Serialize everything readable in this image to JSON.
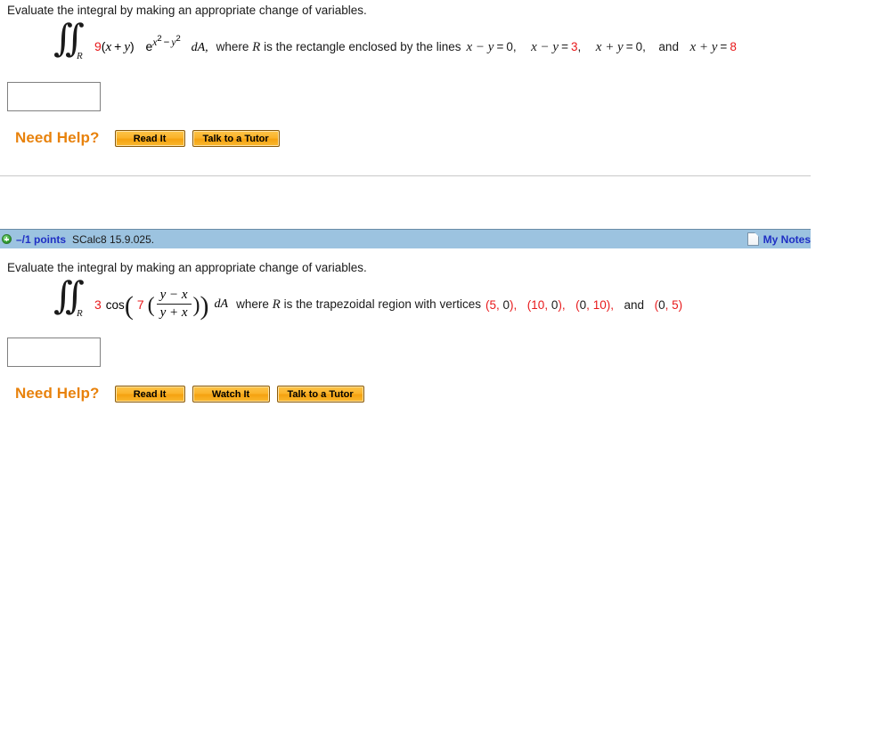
{
  "problem1": {
    "prompt": "Evaluate the integral by making an appropriate change of variables.",
    "integral": {
      "symbol": "∫∫",
      "subscript": "R",
      "coefficient": "9",
      "factor_open": "(",
      "var_x": "x",
      "plus": "+",
      "var_y": "y",
      "factor_close": ")",
      "exp_base": "e",
      "exp_x": "x",
      "exp_x_power": "2",
      "exp_minus": "−",
      "exp_y": "y",
      "exp_y_power": "2",
      "differential": "dA,"
    },
    "where_text_1": "where",
    "where_R": "R",
    "where_text_2": "is the rectangle enclosed by the lines",
    "lines": [
      {
        "lhs": "x − y",
        "eq": "=",
        "rhs": "0",
        "rhs_red": false,
        "trail": ","
      },
      {
        "lhs": "x − y",
        "eq": "=",
        "rhs": "3",
        "rhs_red": true,
        "trail": ","
      },
      {
        "lhs": "x + y",
        "eq": "=",
        "rhs": "0",
        "rhs_red": false,
        "trail": ","
      },
      {
        "lhs": "x + y",
        "eq": "=",
        "rhs": "8",
        "rhs_red": true,
        "trail": ""
      }
    ],
    "and_word": "and",
    "answer_value": "",
    "answer_placeholder": "",
    "need_help_label": "Need Help?",
    "help_buttons": [
      "Read It",
      "Talk to a Tutor"
    ]
  },
  "problem2": {
    "bar": {
      "points": "–/1 points",
      "question_id": "SCalc8 15.9.025.",
      "my_notes": "My Notes"
    },
    "prompt": "Evaluate the integral by making an appropriate change of variables.",
    "integral": {
      "symbol": "∫∫",
      "subscript": "R",
      "coefficient": "3",
      "function": "cos",
      "inner_coefficient": "7",
      "numerator": "y − x",
      "denominator": "y + x",
      "differential": "dA"
    },
    "where_text_1": "where",
    "where_R": "R",
    "where_text_2": "is the trapezoidal region with vertices",
    "vertices": [
      {
        "x": "5",
        "x_red": true,
        "y": "0",
        "y_red": false,
        "trail": ","
      },
      {
        "x": "10",
        "x_red": true,
        "y": "0",
        "y_red": false,
        "trail": ","
      },
      {
        "x": "0",
        "x_red": false,
        "y": "10",
        "y_red": true,
        "trail": ","
      },
      {
        "x": "0",
        "x_red": false,
        "y": "5",
        "y_red": true,
        "trail": ""
      }
    ],
    "and_word": "and",
    "answer_value": "",
    "answer_placeholder": "",
    "need_help_label": "Need Help?",
    "help_buttons": [
      "Read It",
      "Watch It",
      "Talk to a Tutor"
    ]
  },
  "colors": {
    "accent_red": "#e8191b",
    "need_help_orange": "#e8820c",
    "bar_blue": "#9cc3e0",
    "link_blue": "#1f2fc4"
  }
}
